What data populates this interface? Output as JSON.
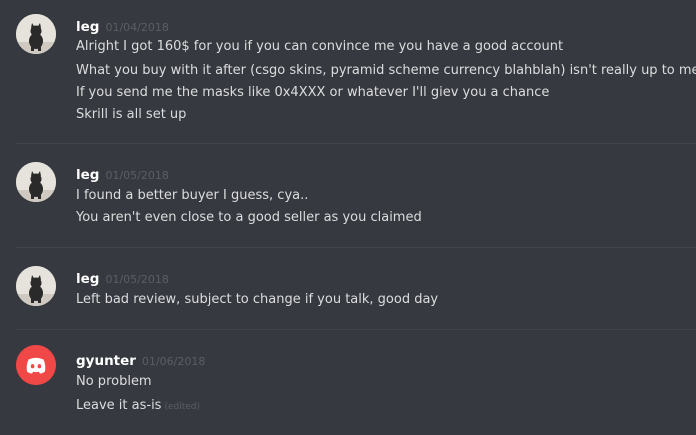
{
  "messages": [
    {
      "username": "leg",
      "timestamp": "01/04/2018",
      "avatar": "cat-photo-avatar",
      "lines": [
        "Alright I got 160$ for you if you can convince me you have a good account",
        "What you buy with it after (csgo skins, pyramid scheme currency blahblah) isn't really up to me",
        "If you send me the masks like 0x4XXX or whatever I'll giev you a chance",
        "Skrill is all set up"
      ]
    },
    {
      "username": "leg",
      "timestamp": "01/05/2018",
      "avatar": "cat-photo-avatar",
      "lines": [
        "I found a better buyer I guess, cya..",
        "You aren't even close to a good seller as you claimed"
      ]
    },
    {
      "username": "leg",
      "timestamp": "01/05/2018",
      "avatar": "cat-photo-avatar",
      "lines": [
        "Left bad review, subject to change if you talk, good day"
      ]
    },
    {
      "username": "gyunter",
      "timestamp": "01/06/2018",
      "avatar": "discord-default-avatar",
      "lines": [
        "No problem",
        "Leave it as-is"
      ],
      "edited_label": "(edited)"
    }
  ],
  "colors": {
    "background": "#36393f",
    "username": "#ffffff",
    "message_text": "#dcddde",
    "timestamp": "#5b5e63",
    "divider": "#42454a",
    "discord_avatar": "#f04747"
  }
}
